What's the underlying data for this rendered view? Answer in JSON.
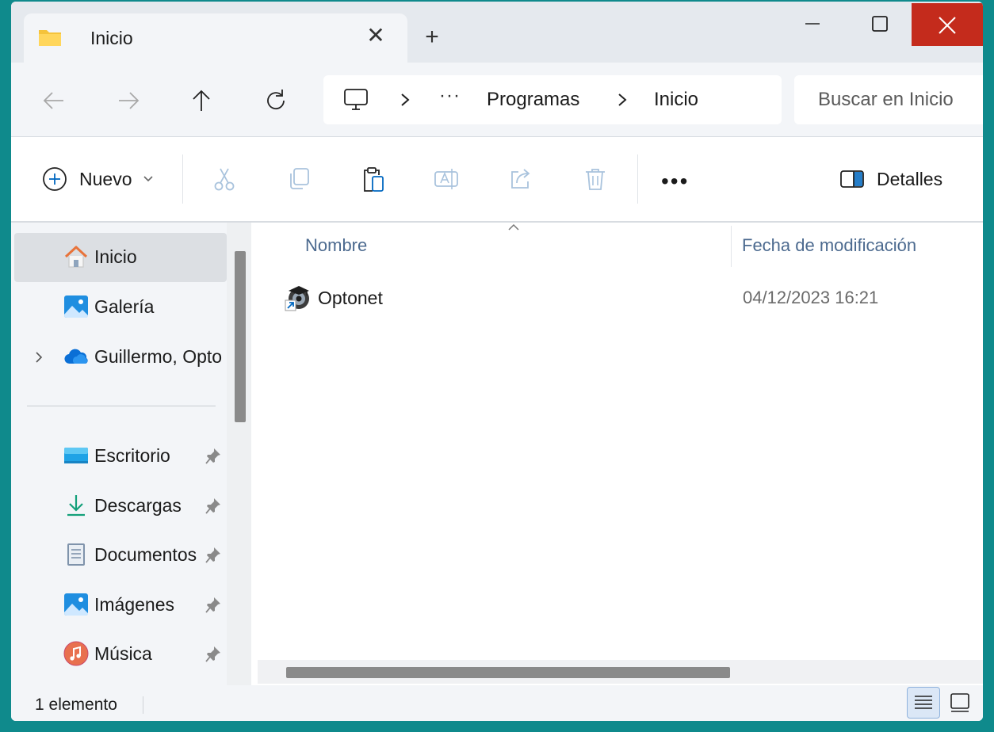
{
  "window": {
    "tab_title": "Inicio",
    "tab_close_glyph": "✕",
    "new_tab_glyph": "+"
  },
  "address_bar": {
    "ellipsis": "···",
    "crumbs": [
      "Programas",
      "Inicio"
    ]
  },
  "search": {
    "placeholder": "Buscar en Inicio"
  },
  "toolbar": {
    "new_label": "Nuevo",
    "more_glyph": "•••",
    "details_label": "Detalles"
  },
  "sidebar": {
    "items": [
      {
        "label": "Inicio",
        "icon": "home-icon",
        "selected": true
      },
      {
        "label": "Galería",
        "icon": "gallery-icon"
      },
      {
        "label": "Guillermo, Opto",
        "icon": "onedrive-cloud-icon",
        "expandable": true
      },
      {
        "label": "Escritorio",
        "icon": "desktop-icon",
        "pinned": true
      },
      {
        "label": "Descargas",
        "icon": "download-icon",
        "pinned": true
      },
      {
        "label": "Documentos",
        "icon": "documents-icon",
        "pinned": true
      },
      {
        "label": "Imágenes",
        "icon": "pictures-icon",
        "pinned": true
      },
      {
        "label": "Música",
        "icon": "music-icon",
        "pinned": true
      }
    ]
  },
  "columns": {
    "name": "Nombre",
    "modified": "Fecha de modificación"
  },
  "files": [
    {
      "name": "Optonet",
      "modified": "04/12/2023 16:21",
      "icon": "shortcut-app-icon"
    }
  ],
  "status": {
    "count": "1 elemento"
  },
  "colors": {
    "desktop_bg": "#0f8a8c",
    "close_red": "#c42b1c",
    "chrome": "#f3f5f8",
    "header_text": "#4c6a8f"
  }
}
